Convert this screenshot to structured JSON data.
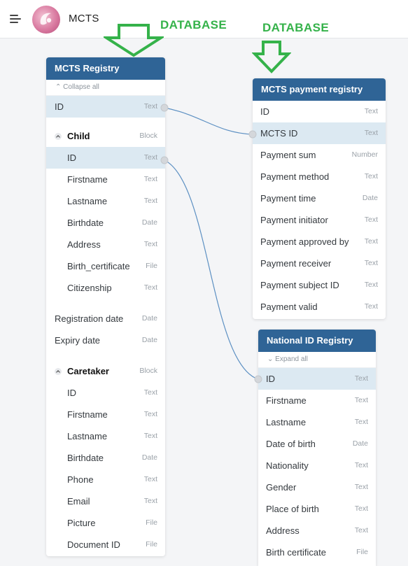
{
  "app": {
    "title": "MCTS"
  },
  "labels": {
    "db_left": "DATABASE",
    "db_right": "DATABASE"
  },
  "colors": {
    "header": "#2f6496",
    "highlight": "#dce9f2",
    "db_label": "#35b24a",
    "connector": "#5b8fc2"
  },
  "registry": {
    "title": "MCTS Registry",
    "collapse": "Collapse all",
    "id_label": "ID",
    "id_type": "Text",
    "child": {
      "label": "Child",
      "type": "Block",
      "fields": [
        {
          "label": "ID",
          "type": "Text"
        },
        {
          "label": "Firstname",
          "type": "Text"
        },
        {
          "label": "Lastname",
          "type": "Text"
        },
        {
          "label": "Birthdate",
          "type": "Date"
        },
        {
          "label": "Address",
          "type": "Text"
        },
        {
          "label": "Birth_certificate",
          "type": "File"
        },
        {
          "label": "Citizenship",
          "type": "Text"
        }
      ]
    },
    "extra": [
      {
        "label": "Registration date",
        "type": "Date"
      },
      {
        "label": "Expiry date",
        "type": "Date"
      }
    ],
    "caretaker": {
      "label": "Caretaker",
      "type": "Block",
      "fields": [
        {
          "label": "ID",
          "type": "Text"
        },
        {
          "label": "Firstname",
          "type": "Text"
        },
        {
          "label": "Lastname",
          "type": "Text"
        },
        {
          "label": "Birthdate",
          "type": "Date"
        },
        {
          "label": "Phone",
          "type": "Text"
        },
        {
          "label": "Email",
          "type": "Text"
        },
        {
          "label": "Picture",
          "type": "File"
        },
        {
          "label": "Document ID",
          "type": "File"
        }
      ]
    }
  },
  "payment": {
    "title": "MCTS payment registry",
    "fields": [
      {
        "label": "ID",
        "type": "Text"
      },
      {
        "label": "MCTS ID",
        "type": "Text"
      },
      {
        "label": "Payment sum",
        "type": "Number"
      },
      {
        "label": "Payment method",
        "type": "Text"
      },
      {
        "label": "Payment time",
        "type": "Date"
      },
      {
        "label": "Payment initiator",
        "type": "Text"
      },
      {
        "label": "Payment approved by",
        "type": "Text"
      },
      {
        "label": "Payment receiver",
        "type": "Text"
      },
      {
        "label": "Payment subject ID",
        "type": "Text"
      },
      {
        "label": "Payment valid",
        "type": "Text"
      }
    ]
  },
  "national": {
    "title": "National ID Registry",
    "expand": "Expand all",
    "fields": [
      {
        "label": "ID",
        "type": "Text"
      },
      {
        "label": "Firstname",
        "type": "Text"
      },
      {
        "label": "Lastname",
        "type": "Text"
      },
      {
        "label": "Date of birth",
        "type": "Date"
      },
      {
        "label": "Nationality",
        "type": "Text"
      },
      {
        "label": "Gender",
        "type": "Text"
      },
      {
        "label": "Place of birth",
        "type": "Text"
      },
      {
        "label": "Address",
        "type": "Text"
      },
      {
        "label": "Birth certificate",
        "type": "File"
      }
    ]
  }
}
